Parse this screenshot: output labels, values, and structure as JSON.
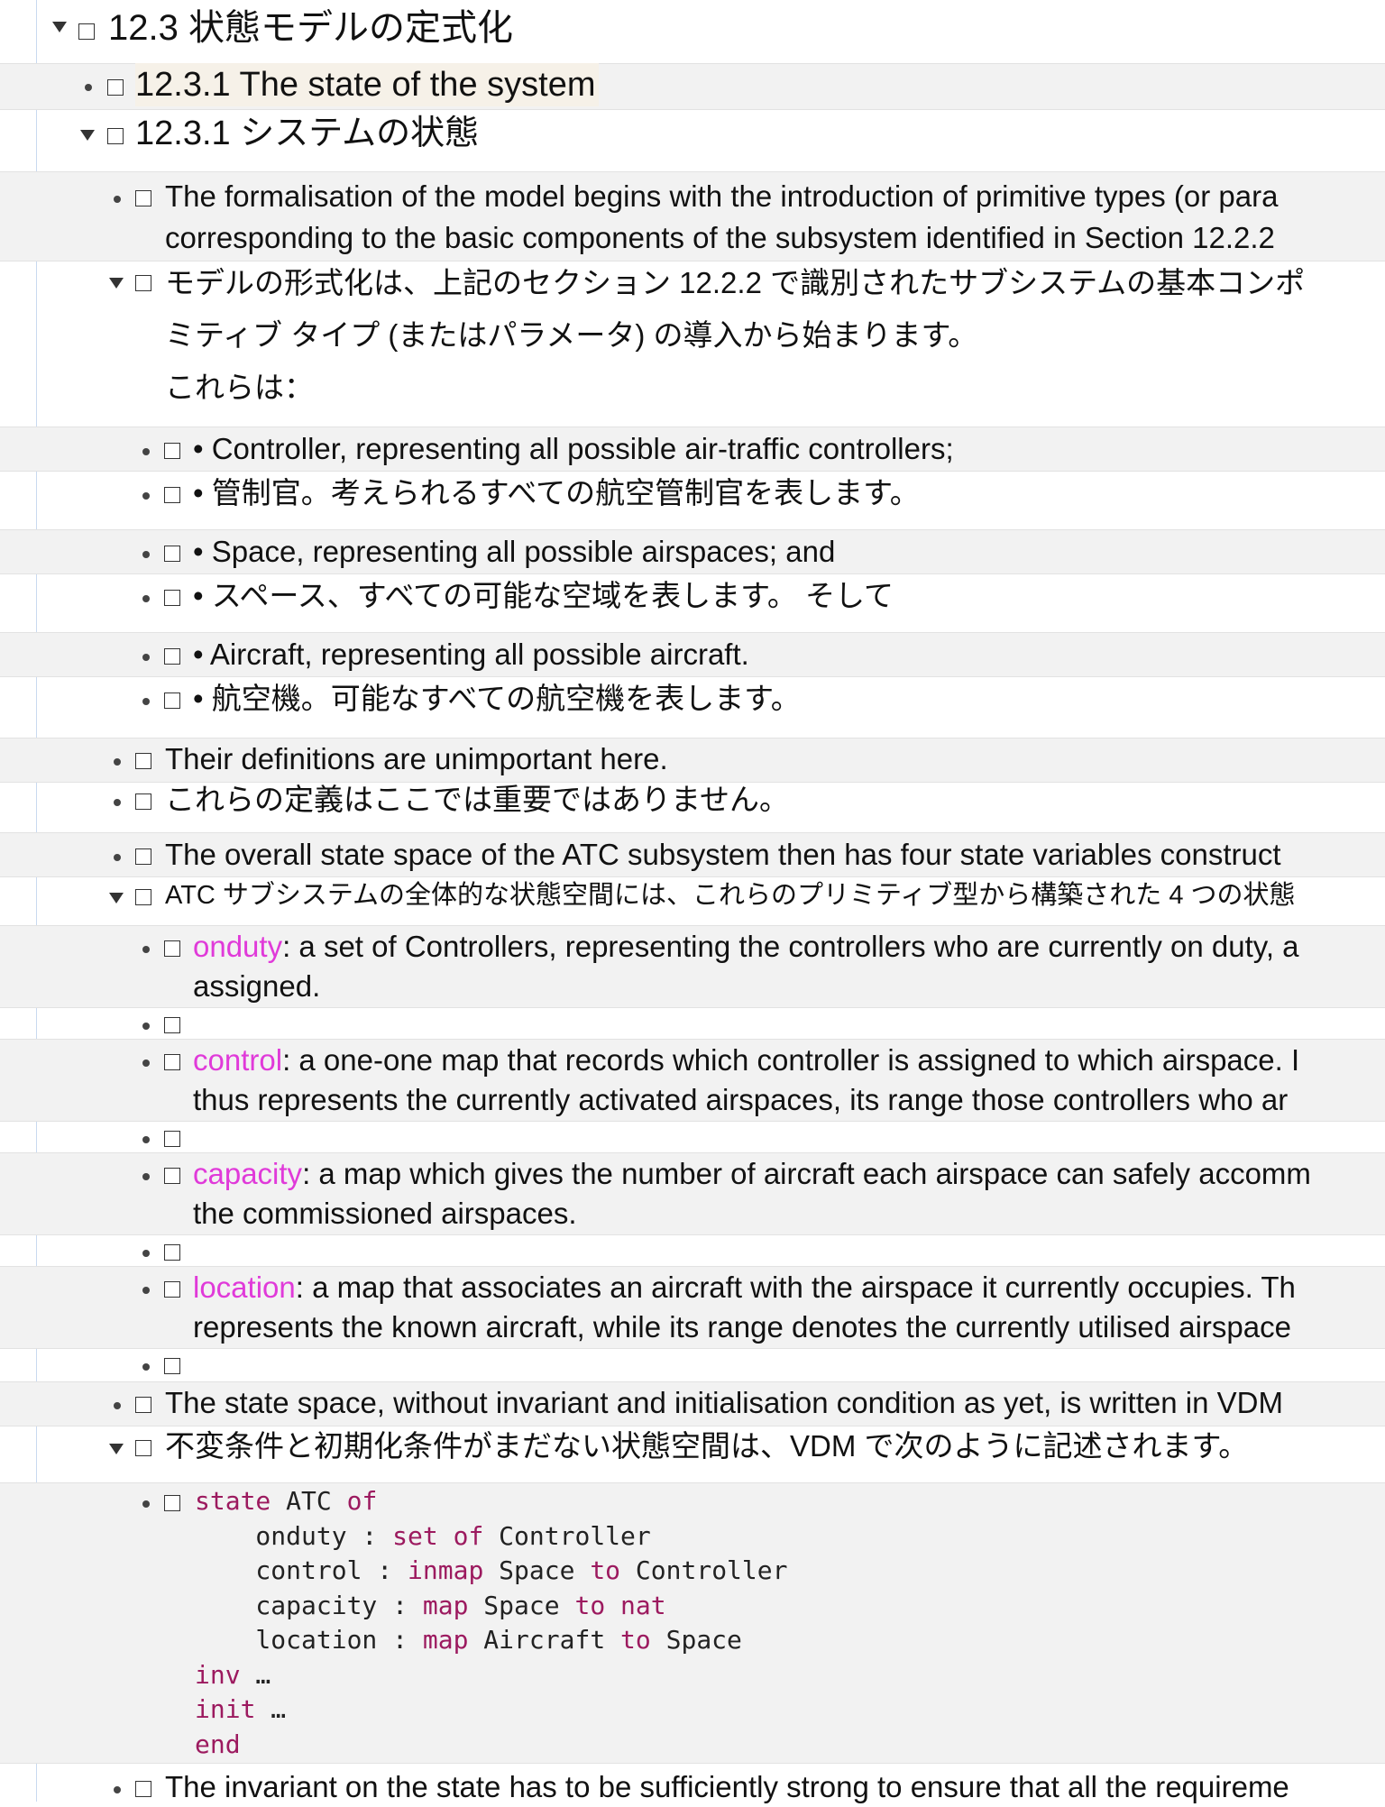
{
  "outline": {
    "h_123": "12.3 状態モデルの定式化",
    "h_1231_en": "12.3.1 The state of the system",
    "h_1231_ja": "12.3.1 システムの状態",
    "p1_en_1": "The formalisation of the model begins with the introduction of primitive types (or para",
    "p1_en_2": "corresponding to the basic components of the subsystem identified in Section 12.2.2",
    "p1_ja_1": "モデルの形式化は、上記のセクション 12.2.2 で識別されたサブシステムの基本コンポ",
    "p1_ja_2": "ミティブ タイプ (またはパラメータ) の導入から始まります。",
    "p1_ja_3": " これらは：",
    "b1_en": "• Controller, representing all possible air-traffic controllers;",
    "b1_ja": "• 管制官。考えられるすべての航空管制官を表します。",
    "b2_en": "• Space, representing all possible airspaces; and",
    "b2_ja": "• スペース、すべての可能な空域を表します。 そして",
    "b3_en": "• Aircraft, representing all possible aircraft.",
    "b3_ja": "• 航空機。可能なすべての航空機を表します。",
    "p2_en": "Their definitions are unimportant here.",
    "p2_ja": "これらの定義はここでは重要ではありません。",
    "p3_en": "The overall state space of the ATC subsystem then has four state variables construct",
    "p3_ja": "ATC サブシステムの全体的な状態空間には、これらのプリミティブ型から構築された 4 つの状態",
    "v1_kw": "onduty",
    "v1_rest": ": a set of Controllers, representing the controllers who are currently on duty, a",
    "v1_line2": "assigned.",
    "v2_kw": "control",
    "v2_rest": ": a one-one map that records which controller is assigned to which airspace. I",
    "v2_line2": "thus represents the currently activated airspaces, its range those controllers who ar",
    "v3_kw": "capacity",
    "v3_rest": ": a map which gives the number of aircraft each airspace can safely accomm",
    "v3_line2": "the commissioned airspaces.",
    "v4_kw": "location",
    "v4_rest": ": a map that associates an aircraft with the airspace it currently occupies. Th",
    "v4_line2": "represents the known aircraft, while its range denotes the currently utilised airspace",
    "p4_en": "The state space, without invariant and initialisation condition as yet, is written in VDM",
    "p4_ja": "不変条件と初期化条件がまだない状態空間は、VDM で次のように記述されます。",
    "code": {
      "l1_kw": "state",
      "l1_rest": " ATC ",
      "l1_kw2": "of",
      "l2_pre": "    onduty : ",
      "l2_kw": "set of",
      "l2_rest": " Controller",
      "l3_pre": "    control : ",
      "l3_kw": "inmap",
      "l3_mid": " Space ",
      "l3_kw2": "to",
      "l3_rest": " Controller",
      "l4_pre": "    capacity : ",
      "l4_kw": "map",
      "l4_mid": " Space ",
      "l4_kw2": "to",
      "l4_sp": " ",
      "l4_kw3": "nat",
      "l5_pre": "    location : ",
      "l5_kw": "map",
      "l5_mid": " Aircraft ",
      "l5_kw2": "to",
      "l5_rest": " Space",
      "l6_kw": "inv",
      "l6_rest": " …",
      "l7_kw": "init",
      "l7_rest": " …",
      "l8_kw": "end"
    },
    "p5_en": "The invariant on the state has to be sufficiently strong to ensure that all the requireme"
  },
  "colors": {
    "keyword": "#e03ad9",
    "code_keyword": "#9c1a5f",
    "band": "#f2f2f2",
    "margin_rule": "#c9d9f0"
  }
}
